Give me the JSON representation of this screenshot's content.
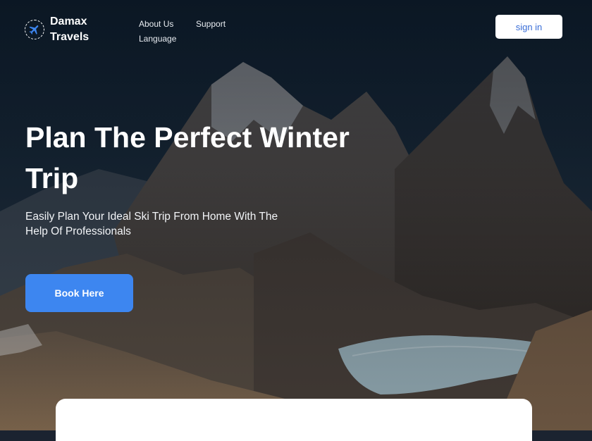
{
  "brand": {
    "line1": "Damax",
    "line2": "Travels",
    "icon": "airplane-icon"
  },
  "nav": {
    "about": "About Us",
    "support": "Support",
    "language": "Language"
  },
  "header": {
    "signin_label": "sign in"
  },
  "hero": {
    "headline": "Plan The Perfect Winter Trip",
    "subheadline": "Easily Plan Your Ideal Ski Trip From Home With The Help Of Professionals",
    "cta_label": "Book Here"
  },
  "colors": {
    "accent": "#3d86f0",
    "signin_text": "#3b6fd8",
    "text_light": "#ffffff"
  }
}
